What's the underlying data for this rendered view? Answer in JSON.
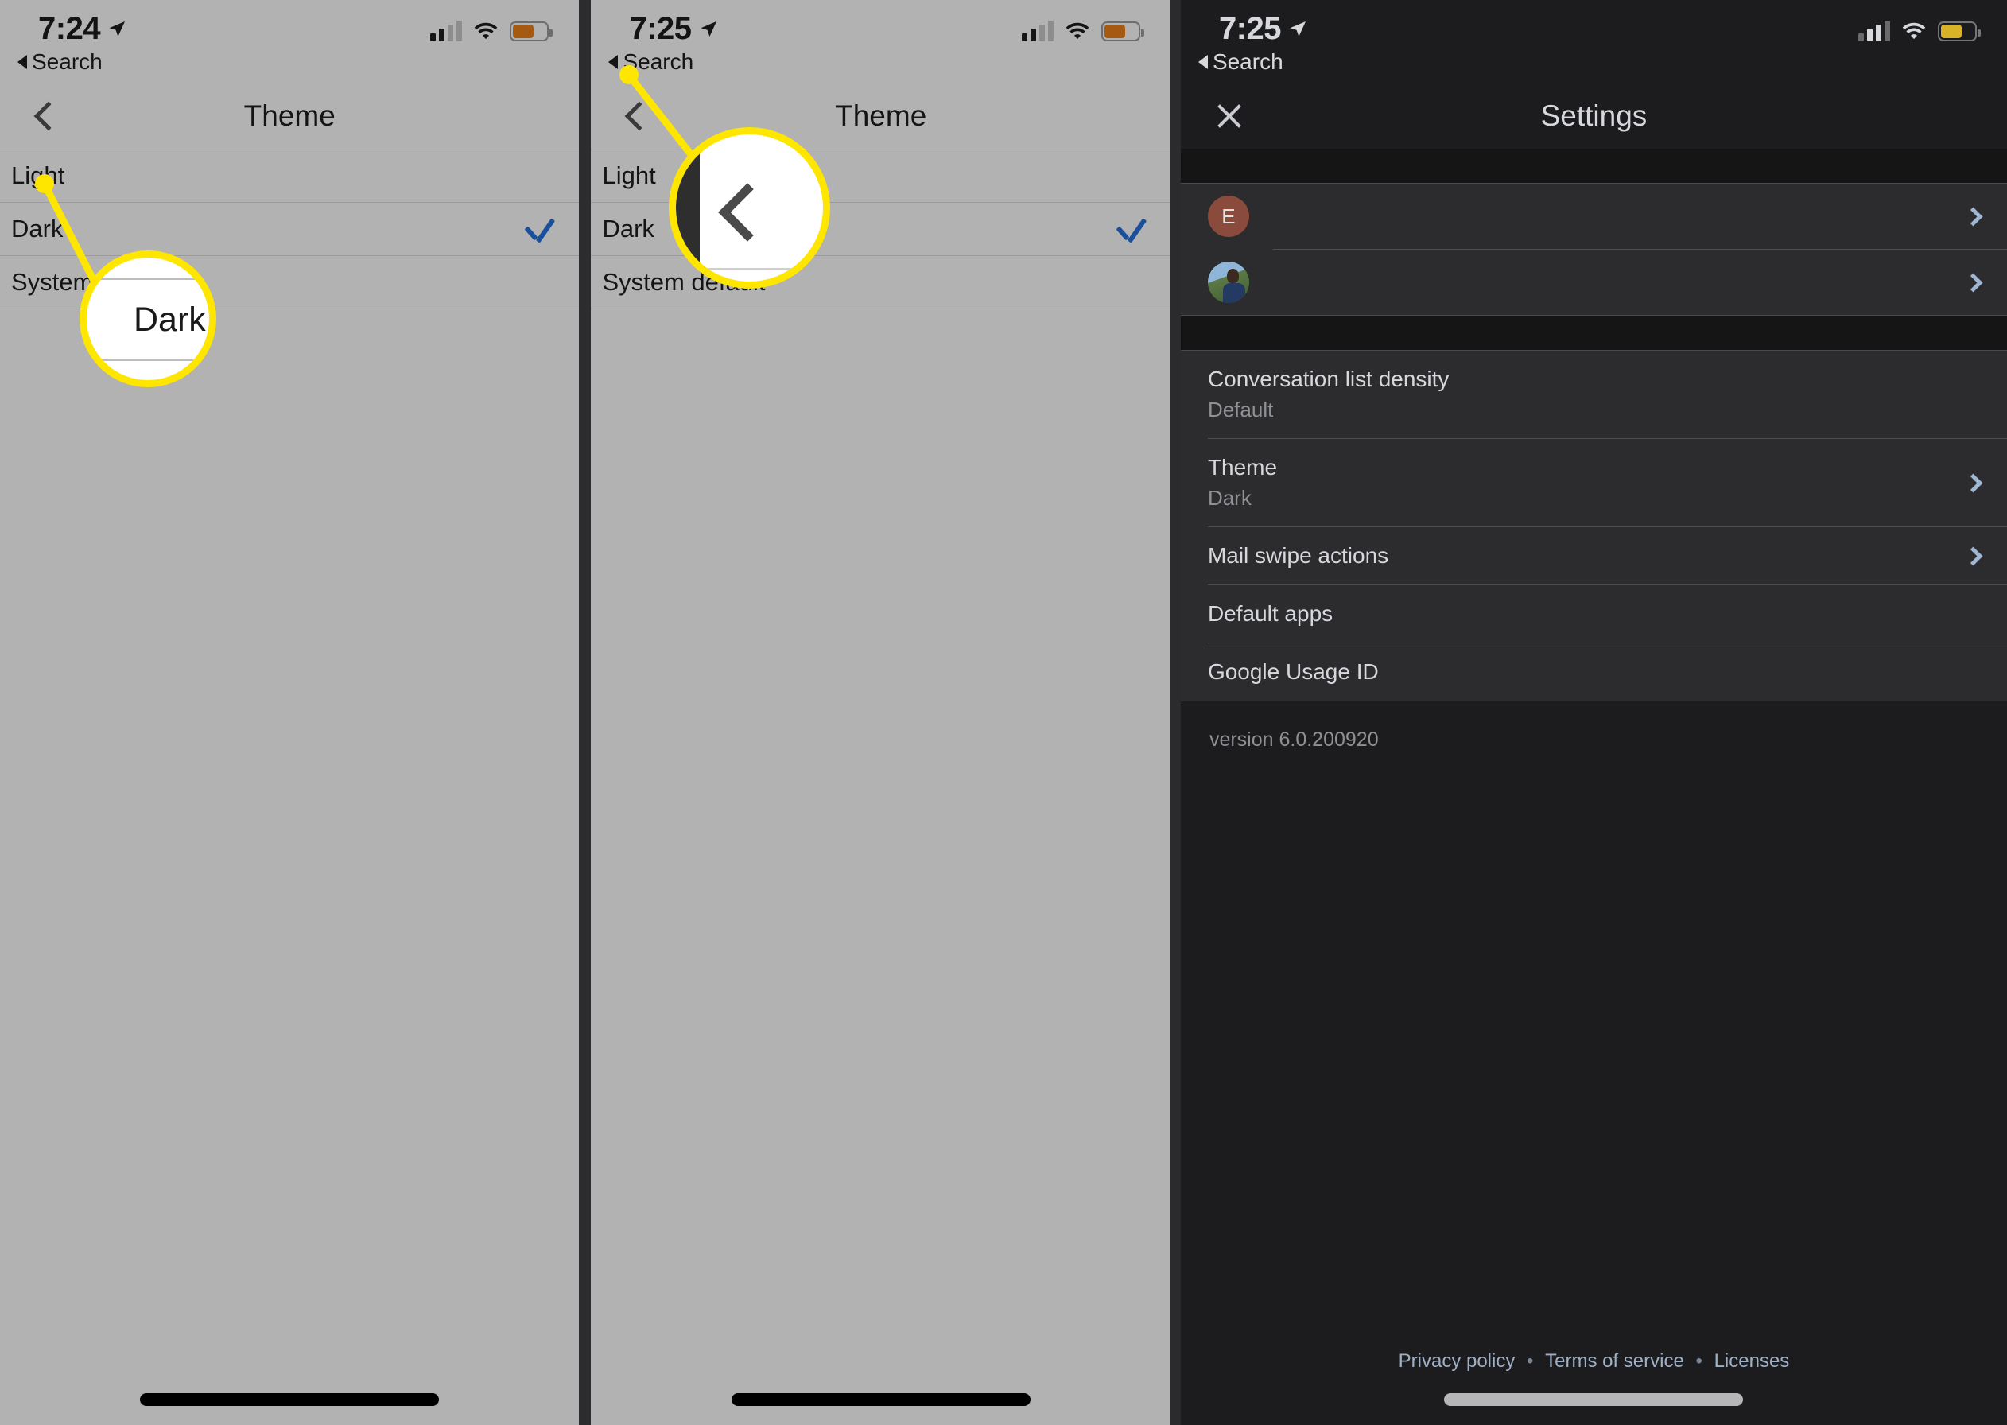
{
  "panels": [
    {
      "id": "theme-before",
      "statusbar": {
        "time": "7:24",
        "back_label": "Search",
        "location_icon": "location-arrow-icon",
        "signal_icon": "cellular-bars-icon",
        "wifi_icon": "wifi-icon",
        "battery_icon": "battery-icon",
        "battery_color": "#a65a11"
      },
      "navbar": {
        "title": "Theme",
        "back_icon": "chevron-left-icon"
      },
      "options": [
        {
          "label": "Light",
          "checked": false
        },
        {
          "label": "Dark",
          "checked": true
        },
        {
          "label": "System default",
          "checked": false
        }
      ],
      "callout": {
        "type": "text",
        "text": "Dark",
        "target": "Dark",
        "highlight_color": "#ffe600"
      }
    },
    {
      "id": "theme-after",
      "statusbar": {
        "time": "7:25",
        "back_label": "Search",
        "location_icon": "location-arrow-icon",
        "signal_icon": "cellular-bars-icon",
        "wifi_icon": "wifi-icon",
        "battery_icon": "battery-icon",
        "battery_color": "#a65a11"
      },
      "navbar": {
        "title": "Theme",
        "back_icon": "chevron-left-icon"
      },
      "options": [
        {
          "label": "Light",
          "checked": false
        },
        {
          "label": "Dark",
          "checked": true
        },
        {
          "label": "System default",
          "checked": false
        }
      ],
      "callout": {
        "type": "icon",
        "icon": "chevron-left-icon",
        "target": "back-button",
        "highlight_color": "#ffe600"
      }
    }
  ],
  "settings": {
    "statusbar": {
      "time": "7:25",
      "back_label": "Search",
      "location_icon": "location-arrow-icon",
      "signal_icon": "cellular-bars-icon",
      "wifi_icon": "wifi-icon",
      "battery_icon": "battery-icon",
      "battery_color": "#d8b328"
    },
    "navbar": {
      "title": "Settings",
      "close_icon": "close-icon"
    },
    "accounts": [
      {
        "avatar_type": "letter",
        "avatar_letter": "E",
        "avatar_color": "#8a4a3c",
        "name": "",
        "chevron": "chevron-right-icon"
      },
      {
        "avatar_type": "photo",
        "avatar_letter": "",
        "avatar_color": "#5c7a46",
        "name": "",
        "chevron": "chevron-right-icon"
      }
    ],
    "rows": [
      {
        "title": "Conversation list density",
        "subtitle": "Default",
        "chevron": false
      },
      {
        "title": "Theme",
        "subtitle": "Dark",
        "chevron": true
      },
      {
        "title": "Mail swipe actions",
        "subtitle": "",
        "chevron": true
      },
      {
        "title": "Default apps",
        "subtitle": "",
        "chevron": false
      },
      {
        "title": "Google Usage ID",
        "subtitle": "",
        "chevron": false
      }
    ],
    "version": "version 6.0.200920",
    "footer": {
      "privacy": "Privacy policy",
      "sep1": "•",
      "terms": "Terms of service",
      "sep2": "•",
      "licenses": "Licenses"
    }
  }
}
